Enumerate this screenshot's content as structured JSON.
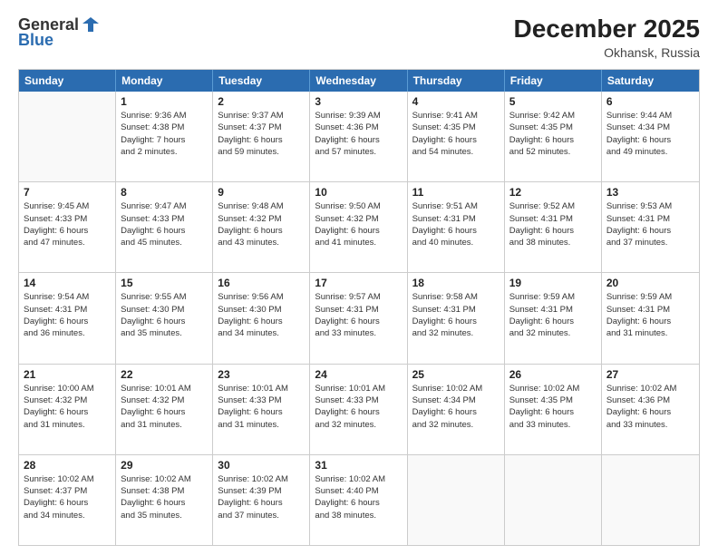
{
  "logo": {
    "general": "General",
    "blue": "Blue"
  },
  "title": {
    "month": "December 2025",
    "location": "Okhansk, Russia"
  },
  "header_days": [
    "Sunday",
    "Monday",
    "Tuesday",
    "Wednesday",
    "Thursday",
    "Friday",
    "Saturday"
  ],
  "weeks": [
    [
      {
        "day": "",
        "empty": true,
        "lines": []
      },
      {
        "day": "1",
        "lines": [
          "Sunrise: 9:36 AM",
          "Sunset: 4:38 PM",
          "Daylight: 7 hours",
          "and 2 minutes."
        ]
      },
      {
        "day": "2",
        "lines": [
          "Sunrise: 9:37 AM",
          "Sunset: 4:37 PM",
          "Daylight: 6 hours",
          "and 59 minutes."
        ]
      },
      {
        "day": "3",
        "lines": [
          "Sunrise: 9:39 AM",
          "Sunset: 4:36 PM",
          "Daylight: 6 hours",
          "and 57 minutes."
        ]
      },
      {
        "day": "4",
        "lines": [
          "Sunrise: 9:41 AM",
          "Sunset: 4:35 PM",
          "Daylight: 6 hours",
          "and 54 minutes."
        ]
      },
      {
        "day": "5",
        "lines": [
          "Sunrise: 9:42 AM",
          "Sunset: 4:35 PM",
          "Daylight: 6 hours",
          "and 52 minutes."
        ]
      },
      {
        "day": "6",
        "lines": [
          "Sunrise: 9:44 AM",
          "Sunset: 4:34 PM",
          "Daylight: 6 hours",
          "and 49 minutes."
        ]
      }
    ],
    [
      {
        "day": "7",
        "lines": [
          "Sunrise: 9:45 AM",
          "Sunset: 4:33 PM",
          "Daylight: 6 hours",
          "and 47 minutes."
        ]
      },
      {
        "day": "8",
        "lines": [
          "Sunrise: 9:47 AM",
          "Sunset: 4:33 PM",
          "Daylight: 6 hours",
          "and 45 minutes."
        ]
      },
      {
        "day": "9",
        "lines": [
          "Sunrise: 9:48 AM",
          "Sunset: 4:32 PM",
          "Daylight: 6 hours",
          "and 43 minutes."
        ]
      },
      {
        "day": "10",
        "lines": [
          "Sunrise: 9:50 AM",
          "Sunset: 4:32 PM",
          "Daylight: 6 hours",
          "and 41 minutes."
        ]
      },
      {
        "day": "11",
        "lines": [
          "Sunrise: 9:51 AM",
          "Sunset: 4:31 PM",
          "Daylight: 6 hours",
          "and 40 minutes."
        ]
      },
      {
        "day": "12",
        "lines": [
          "Sunrise: 9:52 AM",
          "Sunset: 4:31 PM",
          "Daylight: 6 hours",
          "and 38 minutes."
        ]
      },
      {
        "day": "13",
        "lines": [
          "Sunrise: 9:53 AM",
          "Sunset: 4:31 PM",
          "Daylight: 6 hours",
          "and 37 minutes."
        ]
      }
    ],
    [
      {
        "day": "14",
        "lines": [
          "Sunrise: 9:54 AM",
          "Sunset: 4:31 PM",
          "Daylight: 6 hours",
          "and 36 minutes."
        ]
      },
      {
        "day": "15",
        "lines": [
          "Sunrise: 9:55 AM",
          "Sunset: 4:30 PM",
          "Daylight: 6 hours",
          "and 35 minutes."
        ]
      },
      {
        "day": "16",
        "lines": [
          "Sunrise: 9:56 AM",
          "Sunset: 4:30 PM",
          "Daylight: 6 hours",
          "and 34 minutes."
        ]
      },
      {
        "day": "17",
        "lines": [
          "Sunrise: 9:57 AM",
          "Sunset: 4:31 PM",
          "Daylight: 6 hours",
          "and 33 minutes."
        ]
      },
      {
        "day": "18",
        "lines": [
          "Sunrise: 9:58 AM",
          "Sunset: 4:31 PM",
          "Daylight: 6 hours",
          "and 32 minutes."
        ]
      },
      {
        "day": "19",
        "lines": [
          "Sunrise: 9:59 AM",
          "Sunset: 4:31 PM",
          "Daylight: 6 hours",
          "and 32 minutes."
        ]
      },
      {
        "day": "20",
        "lines": [
          "Sunrise: 9:59 AM",
          "Sunset: 4:31 PM",
          "Daylight: 6 hours",
          "and 31 minutes."
        ]
      }
    ],
    [
      {
        "day": "21",
        "lines": [
          "Sunrise: 10:00 AM",
          "Sunset: 4:32 PM",
          "Daylight: 6 hours",
          "and 31 minutes."
        ]
      },
      {
        "day": "22",
        "lines": [
          "Sunrise: 10:01 AM",
          "Sunset: 4:32 PM",
          "Daylight: 6 hours",
          "and 31 minutes."
        ]
      },
      {
        "day": "23",
        "lines": [
          "Sunrise: 10:01 AM",
          "Sunset: 4:33 PM",
          "Daylight: 6 hours",
          "and 31 minutes."
        ]
      },
      {
        "day": "24",
        "lines": [
          "Sunrise: 10:01 AM",
          "Sunset: 4:33 PM",
          "Daylight: 6 hours",
          "and 32 minutes."
        ]
      },
      {
        "day": "25",
        "lines": [
          "Sunrise: 10:02 AM",
          "Sunset: 4:34 PM",
          "Daylight: 6 hours",
          "and 32 minutes."
        ]
      },
      {
        "day": "26",
        "lines": [
          "Sunrise: 10:02 AM",
          "Sunset: 4:35 PM",
          "Daylight: 6 hours",
          "and 33 minutes."
        ]
      },
      {
        "day": "27",
        "lines": [
          "Sunrise: 10:02 AM",
          "Sunset: 4:36 PM",
          "Daylight: 6 hours",
          "and 33 minutes."
        ]
      }
    ],
    [
      {
        "day": "28",
        "lines": [
          "Sunrise: 10:02 AM",
          "Sunset: 4:37 PM",
          "Daylight: 6 hours",
          "and 34 minutes."
        ]
      },
      {
        "day": "29",
        "lines": [
          "Sunrise: 10:02 AM",
          "Sunset: 4:38 PM",
          "Daylight: 6 hours",
          "and 35 minutes."
        ]
      },
      {
        "day": "30",
        "lines": [
          "Sunrise: 10:02 AM",
          "Sunset: 4:39 PM",
          "Daylight: 6 hours",
          "and 37 minutes."
        ]
      },
      {
        "day": "31",
        "lines": [
          "Sunrise: 10:02 AM",
          "Sunset: 4:40 PM",
          "Daylight: 6 hours",
          "and 38 minutes."
        ]
      },
      {
        "day": "",
        "empty": true,
        "lines": []
      },
      {
        "day": "",
        "empty": true,
        "lines": []
      },
      {
        "day": "",
        "empty": true,
        "lines": []
      }
    ]
  ]
}
